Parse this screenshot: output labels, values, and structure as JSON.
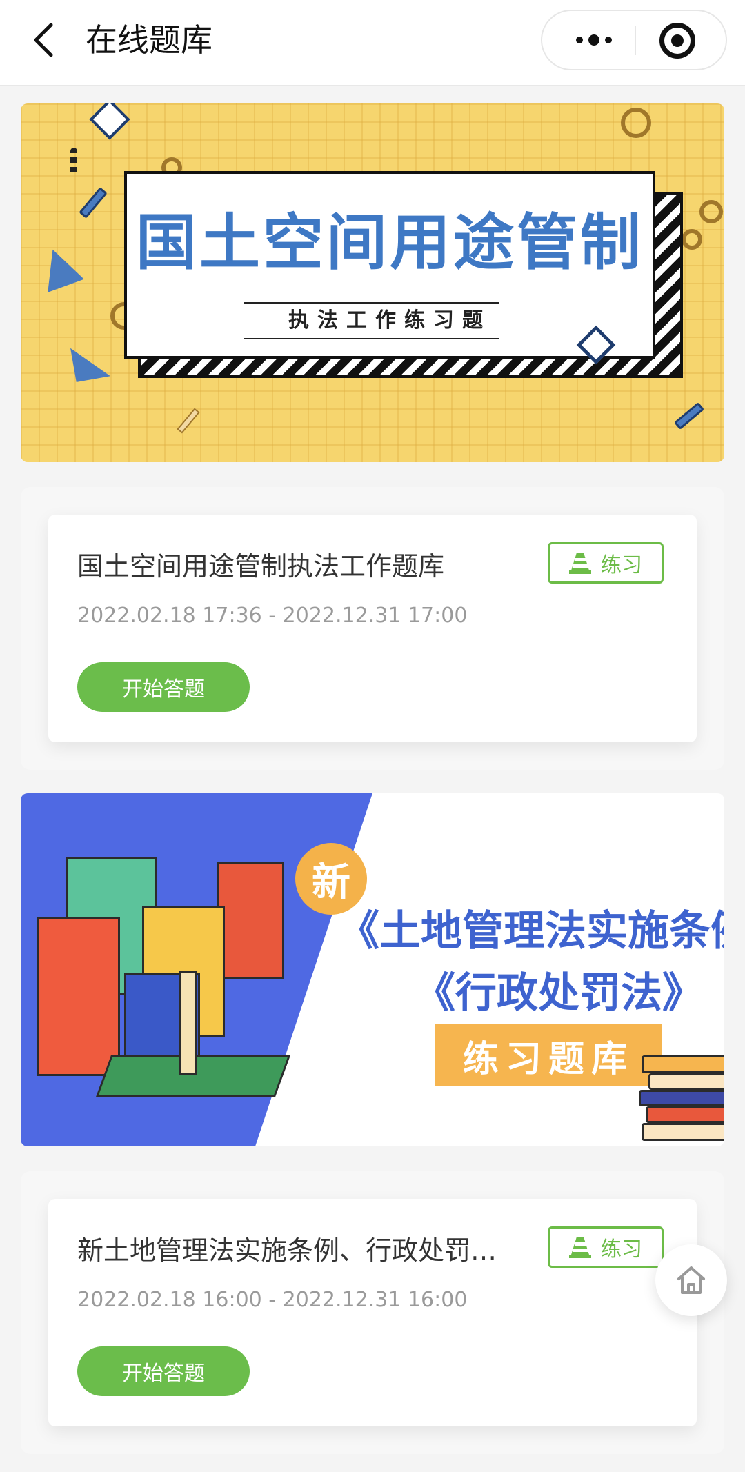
{
  "navbar": {
    "title": "在线题库"
  },
  "banner1": {
    "title": "国土空间用途管制",
    "subtitle": "执法工作练习题"
  },
  "banner2": {
    "badge": "新",
    "line1": "《土地管理法实施条例》",
    "line2": "《行政处罚法》",
    "pill": "练习题库"
  },
  "cards": [
    {
      "title": "国土空间用途管制执法工作题库",
      "tag": "练习",
      "time": "2022.02.18 17:36 - 2022.12.31 17:00",
      "button": "开始答题"
    },
    {
      "title": "新土地管理法实施条例、行政处罚法练习题库",
      "tag": "练习",
      "time": "2022.02.18 16:00 - 2022.12.31 16:00",
      "button": "开始答题"
    }
  ],
  "colors": {
    "accent_green": "#6bbd4b",
    "banner1_bg": "#f6d56e",
    "banner1_title": "#3e78c4",
    "banner2_blue": "#4f69e3",
    "banner2_orange": "#f6b54f"
  },
  "icons": {
    "back": "chevron-left-icon",
    "more": "more-dots-icon",
    "close": "target-circle-icon",
    "tag": "traffic-cone-icon",
    "home": "home-icon"
  }
}
